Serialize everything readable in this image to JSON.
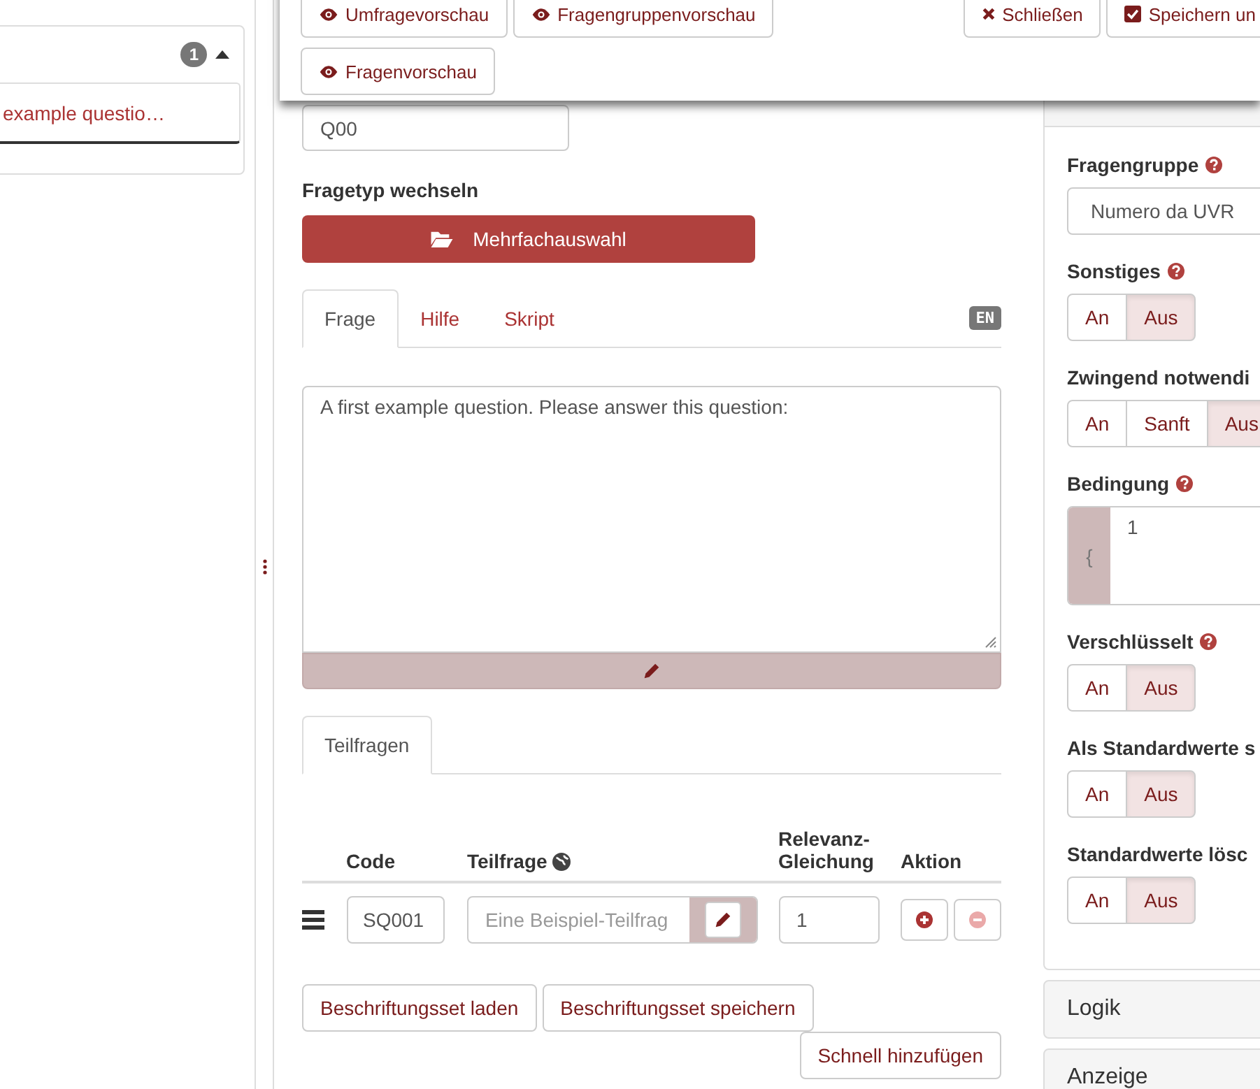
{
  "sidebar": {
    "group": {
      "count": "1",
      "expanded": true,
      "questions": [
        {
          "title": "example questio…"
        }
      ]
    }
  },
  "toolbar": {
    "left_buttons": [
      {
        "label": "Umfragevorschau",
        "kind": "preview"
      },
      {
        "label": "Fragengruppenvorschau",
        "kind": "preview"
      }
    ],
    "right_buttons": [
      {
        "label": "Schließen",
        "kind": "close"
      },
      {
        "label": "Speichern un",
        "kind": "save"
      }
    ],
    "second_row": [
      {
        "label": "Fragenvorschau",
        "kind": "preview"
      }
    ]
  },
  "editor": {
    "code": "Q00",
    "question_type_label": "Fragetyp wechseln",
    "question_type": "Mehrfachauswahl",
    "tabs": [
      {
        "label": "Frage",
        "selected": true
      },
      {
        "label": "Hilfe",
        "selected": false
      },
      {
        "label": "Skript",
        "selected": false
      }
    ],
    "language": "EN",
    "question_text": "A first example question. Please answer this question:",
    "subquestion_tabs": [
      {
        "label": "Teilfragen",
        "selected": true
      }
    ],
    "subquestions": {
      "columns": [
        {
          "label": "Code",
          "globe": false
        },
        {
          "label": "Teilfrage",
          "globe": true
        },
        {
          "label": "Relevanz-Gleichung",
          "globe": false
        },
        {
          "label": "Aktion",
          "globe": false
        }
      ],
      "rows": [
        {
          "code": "SQ001",
          "placeholder": "Eine Beispiel-Teilfrag",
          "relevance": "1",
          "actions": [
            {
              "kind": "add",
              "disabled": false
            },
            {
              "kind": "remove",
              "disabled": true
            }
          ]
        }
      ]
    },
    "label_buttons": [
      "Beschriftungsset laden",
      "Beschriftungsset speichern"
    ],
    "quick_add": "Schnell hinzufügen"
  },
  "settings": {
    "fields": [
      {
        "kind": "select",
        "label": "Fragengruppe",
        "help": true,
        "value": "Numero da UVR"
      },
      {
        "kind": "toggle",
        "label": "Sonstiges",
        "help": true,
        "options": [
          {
            "label": "An",
            "selected": false
          },
          {
            "label": "Aus",
            "selected": true
          }
        ]
      },
      {
        "kind": "toggle",
        "label": "Zwingend notwendi",
        "help": false,
        "options": [
          {
            "label": "An",
            "selected": false
          },
          {
            "label": "Sanft",
            "selected": false
          },
          {
            "label": "Aus",
            "selected": true
          }
        ]
      },
      {
        "kind": "code",
        "label": "Bedingung",
        "help": true,
        "gutter": "{",
        "value": "1"
      },
      {
        "kind": "toggle",
        "label": "Verschlüsselt",
        "help": true,
        "options": [
          {
            "label": "An",
            "selected": false
          },
          {
            "label": "Aus",
            "selected": true
          }
        ]
      },
      {
        "kind": "toggle",
        "label": "Als Standardwerte s",
        "help": false,
        "options": [
          {
            "label": "An",
            "selected": false
          },
          {
            "label": "Aus",
            "selected": true
          }
        ]
      },
      {
        "kind": "toggle",
        "label": "Standardwerte lösc",
        "help": false,
        "options": [
          {
            "label": "An",
            "selected": false
          },
          {
            "label": "Aus",
            "selected": true
          }
        ]
      }
    ],
    "panels": [
      {
        "label": "Logik"
      },
      {
        "label": "Anzeige"
      }
    ]
  }
}
